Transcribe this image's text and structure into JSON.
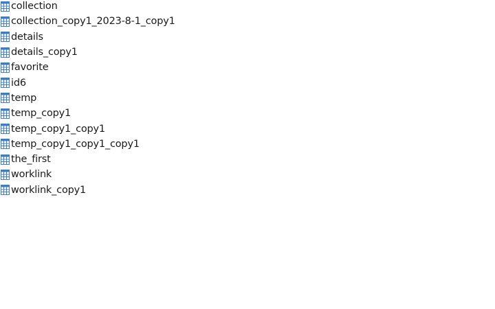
{
  "tables": [
    {
      "label": "collection",
      "icon": "table-icon"
    },
    {
      "label": "collection_copy1_2023-8-1_copy1",
      "icon": "table-icon"
    },
    {
      "label": "details",
      "icon": "table-icon"
    },
    {
      "label": "details_copy1",
      "icon": "table-icon"
    },
    {
      "label": "favorite",
      "icon": "table-icon"
    },
    {
      "label": "id6",
      "icon": "table-icon"
    },
    {
      "label": "temp",
      "icon": "table-icon"
    },
    {
      "label": "temp_copy1",
      "icon": "table-icon"
    },
    {
      "label": "temp_copy1_copy1",
      "icon": "table-icon"
    },
    {
      "label": "temp_copy1_copy1_copy1",
      "icon": "table-icon"
    },
    {
      "label": "the_first",
      "icon": "table-icon"
    },
    {
      "label": "worklink",
      "icon": "table-icon"
    },
    {
      "label": "worklink_copy1",
      "icon": "table-icon"
    }
  ],
  "colors": {
    "icon_border": "#3d7cc9",
    "icon_header": "#3d7cc9",
    "icon_grid": "#3d7cc9",
    "icon_fill": "#ffffff",
    "text": "#1a1a1a",
    "background": "#ffffff"
  }
}
